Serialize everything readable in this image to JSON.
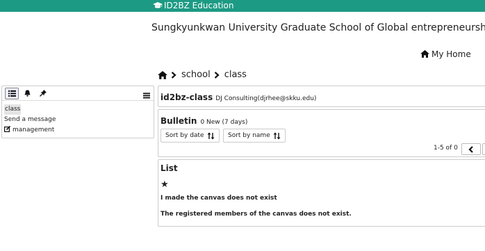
{
  "header": {
    "brand": "ID2BZ Education",
    "brand_icon": "graduation-cap-icon",
    "school_name": "Sungkyunkwan University Graduate School of Global entrepreneurship",
    "my_home": "My Home",
    "bar_color": "#1d9a84"
  },
  "breadcrumb": {
    "items": [
      "school",
      "class"
    ]
  },
  "sidebar": {
    "tabs": [
      "list-icon",
      "bell-icon",
      "pin-icon"
    ],
    "menu_icon": "menu-icon",
    "items": [
      {
        "label": "class"
      },
      {
        "label": "Send a message"
      },
      {
        "label": "management",
        "icon": "edit-icon"
      }
    ]
  },
  "class_info": {
    "title": "id2bz-class",
    "subtitle": "DJ Consulting(djrhee@skku.edu)"
  },
  "bulletin": {
    "title": "Bulletin",
    "status": "0 New (7 days)",
    "sort_date": "Sort by date",
    "sort_name": "Sort by name",
    "pagination": "1-5 of 0"
  },
  "list": {
    "title": "List",
    "star": "★",
    "message1": "I made the canvas does not exist",
    "message2": "The registered members of the canvas does not exist."
  }
}
